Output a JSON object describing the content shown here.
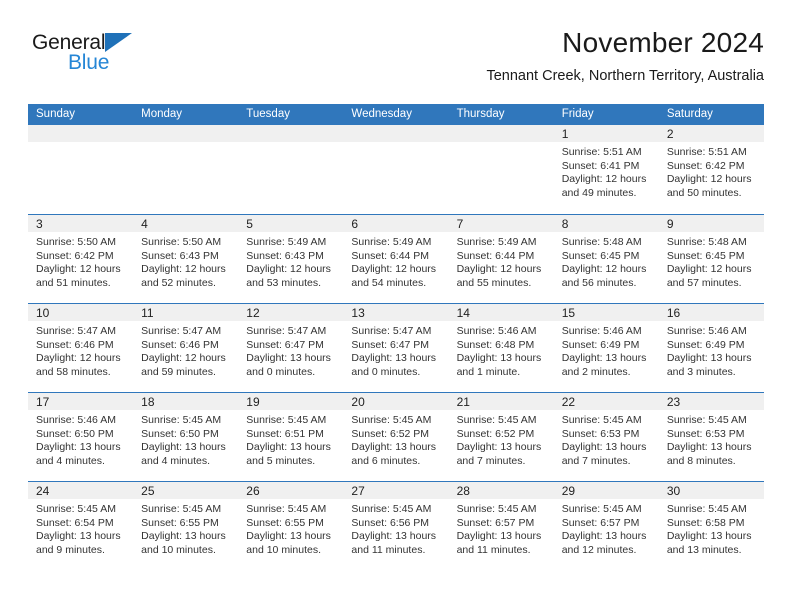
{
  "brand": {
    "name_line1": "General",
    "name_line2": "Blue",
    "logo_icon": "triangle-flag-icon"
  },
  "header": {
    "month_title": "November 2024",
    "location": "Tennant Creek, Northern Territory, Australia"
  },
  "colors": {
    "header_blue": "#3077bc",
    "brand_blue": "#2586d6",
    "daynum_band": "#f0f0f0",
    "text": "#222222"
  },
  "weekday_headers": [
    "Sunday",
    "Monday",
    "Tuesday",
    "Wednesday",
    "Thursday",
    "Friday",
    "Saturday"
  ],
  "weeks": [
    [
      {
        "blank": true
      },
      {
        "blank": true
      },
      {
        "blank": true
      },
      {
        "blank": true
      },
      {
        "blank": true
      },
      {
        "day": "1",
        "sunrise": "Sunrise: 5:51 AM",
        "sunset": "Sunset: 6:41 PM",
        "daylight": "Daylight: 12 hours and 49 minutes."
      },
      {
        "day": "2",
        "sunrise": "Sunrise: 5:51 AM",
        "sunset": "Sunset: 6:42 PM",
        "daylight": "Daylight: 12 hours and 50 minutes."
      }
    ],
    [
      {
        "day": "3",
        "sunrise": "Sunrise: 5:50 AM",
        "sunset": "Sunset: 6:42 PM",
        "daylight": "Daylight: 12 hours and 51 minutes."
      },
      {
        "day": "4",
        "sunrise": "Sunrise: 5:50 AM",
        "sunset": "Sunset: 6:43 PM",
        "daylight": "Daylight: 12 hours and 52 minutes."
      },
      {
        "day": "5",
        "sunrise": "Sunrise: 5:49 AM",
        "sunset": "Sunset: 6:43 PM",
        "daylight": "Daylight: 12 hours and 53 minutes."
      },
      {
        "day": "6",
        "sunrise": "Sunrise: 5:49 AM",
        "sunset": "Sunset: 6:44 PM",
        "daylight": "Daylight: 12 hours and 54 minutes."
      },
      {
        "day": "7",
        "sunrise": "Sunrise: 5:49 AM",
        "sunset": "Sunset: 6:44 PM",
        "daylight": "Daylight: 12 hours and 55 minutes."
      },
      {
        "day": "8",
        "sunrise": "Sunrise: 5:48 AM",
        "sunset": "Sunset: 6:45 PM",
        "daylight": "Daylight: 12 hours and 56 minutes."
      },
      {
        "day": "9",
        "sunrise": "Sunrise: 5:48 AM",
        "sunset": "Sunset: 6:45 PM",
        "daylight": "Daylight: 12 hours and 57 minutes."
      }
    ],
    [
      {
        "day": "10",
        "sunrise": "Sunrise: 5:47 AM",
        "sunset": "Sunset: 6:46 PM",
        "daylight": "Daylight: 12 hours and 58 minutes."
      },
      {
        "day": "11",
        "sunrise": "Sunrise: 5:47 AM",
        "sunset": "Sunset: 6:46 PM",
        "daylight": "Daylight: 12 hours and 59 minutes."
      },
      {
        "day": "12",
        "sunrise": "Sunrise: 5:47 AM",
        "sunset": "Sunset: 6:47 PM",
        "daylight": "Daylight: 13 hours and 0 minutes."
      },
      {
        "day": "13",
        "sunrise": "Sunrise: 5:47 AM",
        "sunset": "Sunset: 6:47 PM",
        "daylight": "Daylight: 13 hours and 0 minutes."
      },
      {
        "day": "14",
        "sunrise": "Sunrise: 5:46 AM",
        "sunset": "Sunset: 6:48 PM",
        "daylight": "Daylight: 13 hours and 1 minute."
      },
      {
        "day": "15",
        "sunrise": "Sunrise: 5:46 AM",
        "sunset": "Sunset: 6:49 PM",
        "daylight": "Daylight: 13 hours and 2 minutes."
      },
      {
        "day": "16",
        "sunrise": "Sunrise: 5:46 AM",
        "sunset": "Sunset: 6:49 PM",
        "daylight": "Daylight: 13 hours and 3 minutes."
      }
    ],
    [
      {
        "day": "17",
        "sunrise": "Sunrise: 5:46 AM",
        "sunset": "Sunset: 6:50 PM",
        "daylight": "Daylight: 13 hours and 4 minutes."
      },
      {
        "day": "18",
        "sunrise": "Sunrise: 5:45 AM",
        "sunset": "Sunset: 6:50 PM",
        "daylight": "Daylight: 13 hours and 4 minutes."
      },
      {
        "day": "19",
        "sunrise": "Sunrise: 5:45 AM",
        "sunset": "Sunset: 6:51 PM",
        "daylight": "Daylight: 13 hours and 5 minutes."
      },
      {
        "day": "20",
        "sunrise": "Sunrise: 5:45 AM",
        "sunset": "Sunset: 6:52 PM",
        "daylight": "Daylight: 13 hours and 6 minutes."
      },
      {
        "day": "21",
        "sunrise": "Sunrise: 5:45 AM",
        "sunset": "Sunset: 6:52 PM",
        "daylight": "Daylight: 13 hours and 7 minutes."
      },
      {
        "day": "22",
        "sunrise": "Sunrise: 5:45 AM",
        "sunset": "Sunset: 6:53 PM",
        "daylight": "Daylight: 13 hours and 7 minutes."
      },
      {
        "day": "23",
        "sunrise": "Sunrise: 5:45 AM",
        "sunset": "Sunset: 6:53 PM",
        "daylight": "Daylight: 13 hours and 8 minutes."
      }
    ],
    [
      {
        "day": "24",
        "sunrise": "Sunrise: 5:45 AM",
        "sunset": "Sunset: 6:54 PM",
        "daylight": "Daylight: 13 hours and 9 minutes."
      },
      {
        "day": "25",
        "sunrise": "Sunrise: 5:45 AM",
        "sunset": "Sunset: 6:55 PM",
        "daylight": "Daylight: 13 hours and 10 minutes."
      },
      {
        "day": "26",
        "sunrise": "Sunrise: 5:45 AM",
        "sunset": "Sunset: 6:55 PM",
        "daylight": "Daylight: 13 hours and 10 minutes."
      },
      {
        "day": "27",
        "sunrise": "Sunrise: 5:45 AM",
        "sunset": "Sunset: 6:56 PM",
        "daylight": "Daylight: 13 hours and 11 minutes."
      },
      {
        "day": "28",
        "sunrise": "Sunrise: 5:45 AM",
        "sunset": "Sunset: 6:57 PM",
        "daylight": "Daylight: 13 hours and 11 minutes."
      },
      {
        "day": "29",
        "sunrise": "Sunrise: 5:45 AM",
        "sunset": "Sunset: 6:57 PM",
        "daylight": "Daylight: 13 hours and 12 minutes."
      },
      {
        "day": "30",
        "sunrise": "Sunrise: 5:45 AM",
        "sunset": "Sunset: 6:58 PM",
        "daylight": "Daylight: 13 hours and 13 minutes."
      }
    ]
  ]
}
